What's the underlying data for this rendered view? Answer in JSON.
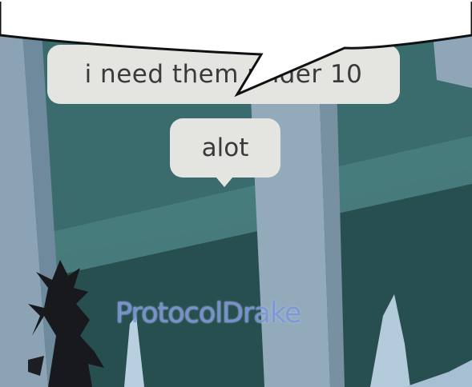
{
  "chat": {
    "bubbles": [
      {
        "text": "i need them under 10"
      },
      {
        "text": "alot"
      }
    ]
  },
  "player": {
    "name": "ProtocolDrake"
  },
  "colors": {
    "bubble_bg": "#e4e4e1",
    "bubble_text": "#3a3a3a",
    "name_tag": "#7d97d6",
    "sky": "#2f5a5c",
    "pillar": "#8ea5b8"
  }
}
